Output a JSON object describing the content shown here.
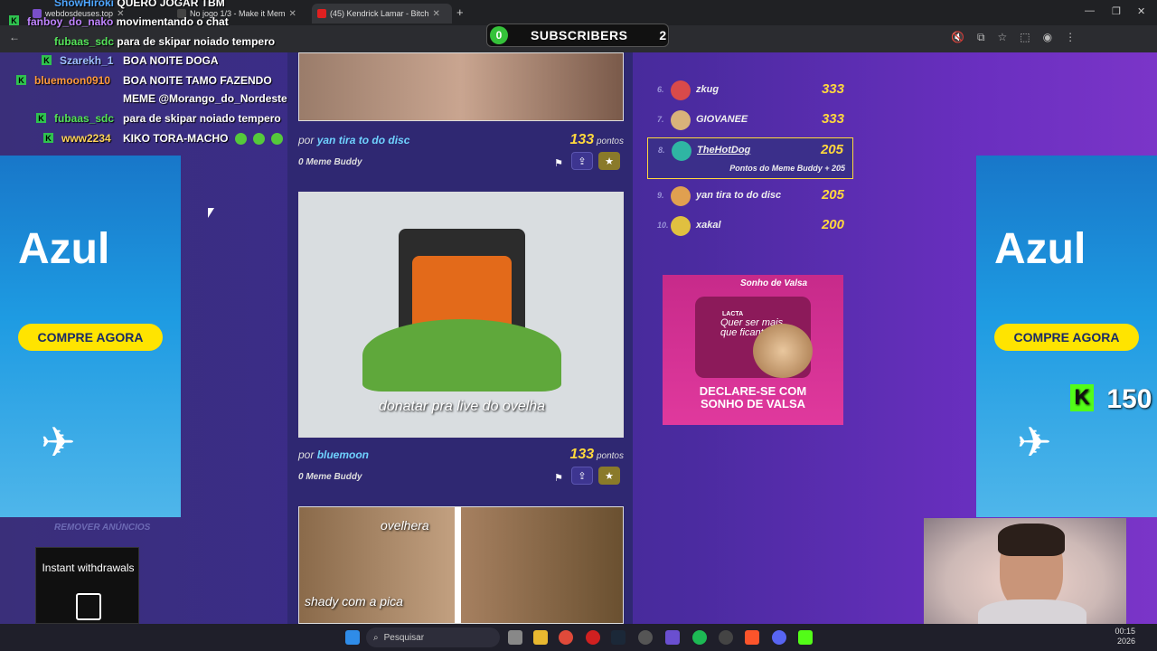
{
  "browser": {
    "tabs": [
      {
        "label": "webdosdeuses.top"
      },
      {
        "label": "No jogo 1/3 - Make it Mem"
      },
      {
        "label": "(45) Kendrick Lamar - Bitch"
      }
    ]
  },
  "stream_overlay": {
    "subscribers_label": "SUBSCRIBERS",
    "subscribers_count": "2",
    "subscribers_badge": "0",
    "chat": [
      {
        "user": "ShowHiroki",
        "msg": "QUERO JOGAR TBM",
        "user_color": "#4ea6ff"
      },
      {
        "user": "fanboy_do_nako",
        "msg": "movimentando o chat",
        "user_color": "#c084ff"
      },
      {
        "user": "fubaas_sdc",
        "msg": "para de skipar noiado tempero",
        "user_color": "#55e35a"
      },
      {
        "user": "Szarekh_1",
        "msg": "BOA NOITE DOGA",
        "user_color": "#9fc0ff"
      },
      {
        "user": "bluemoon0910",
        "msg": "BOA NOITE TAMO FAZENDO",
        "user_color": "#ff9a3c"
      },
      {
        "user": "",
        "msg": "MEME @Morango_do_Nordeste",
        "user_color": "#ffffff"
      },
      {
        "user": "fubaas_sdc",
        "msg": "para de skipar noiado tempero",
        "user_color": "#55e35a"
      },
      {
        "user": "www2234",
        "msg": "KIKO TORA-MACHO",
        "user_color": "#ffd35a"
      }
    ],
    "kick_amount": "150"
  },
  "ads": {
    "azul_brand": "Azul",
    "azul_cta": "COMPRE AGORA",
    "remove_ads": "REMOVER ANÚNCIOS",
    "sonho_tagline": "DECLARE-SE COM SONHO DE VALSA",
    "sonho_line1": "DECLARE-SE COM",
    "sonho_line2": "SONHO DE VALSA",
    "sonho_caption": "Quer ser mais que ficante?",
    "sonho_brand": "Sonho de Valsa",
    "lacta": "LACTA",
    "instant_withdrawals": "Instant withdrawals"
  },
  "feed": [
    {
      "image_text": "",
      "author_prefix": "por",
      "author": "yan tira to do disc",
      "points": "133",
      "points_label": "pontos",
      "buddy": "0 Meme Buddy"
    },
    {
      "image_text": "donatar pra live do ovelha",
      "author_prefix": "por",
      "author": "bluemoon",
      "points": "133",
      "points_label": "pontos",
      "buddy": "0 Meme Buddy"
    },
    {
      "image_text_top": "ovelhera",
      "image_text_bottom": "shady com a pica"
    }
  ],
  "ranking": [
    {
      "pos": "6.",
      "name": "zkug",
      "points": "333",
      "color": "#d94a4a"
    },
    {
      "pos": "7.",
      "name": "GIOVANEE",
      "points": "333",
      "color": "#d9b27a"
    },
    {
      "pos": "8.",
      "name": "TheHotDog",
      "points": "205",
      "color": "#2fb5a3",
      "sub": "Pontos do Meme Buddy + 205"
    },
    {
      "pos": "9.",
      "name": "yan tira to do disc",
      "points": "205",
      "color": "#e0a050"
    },
    {
      "pos": "10.",
      "name": "xakal",
      "points": "200",
      "color": "#e0c040"
    }
  ],
  "taskbar": {
    "search_placeholder": "Pesquisar",
    "time": "00:15",
    "date_suffix": "2026"
  }
}
